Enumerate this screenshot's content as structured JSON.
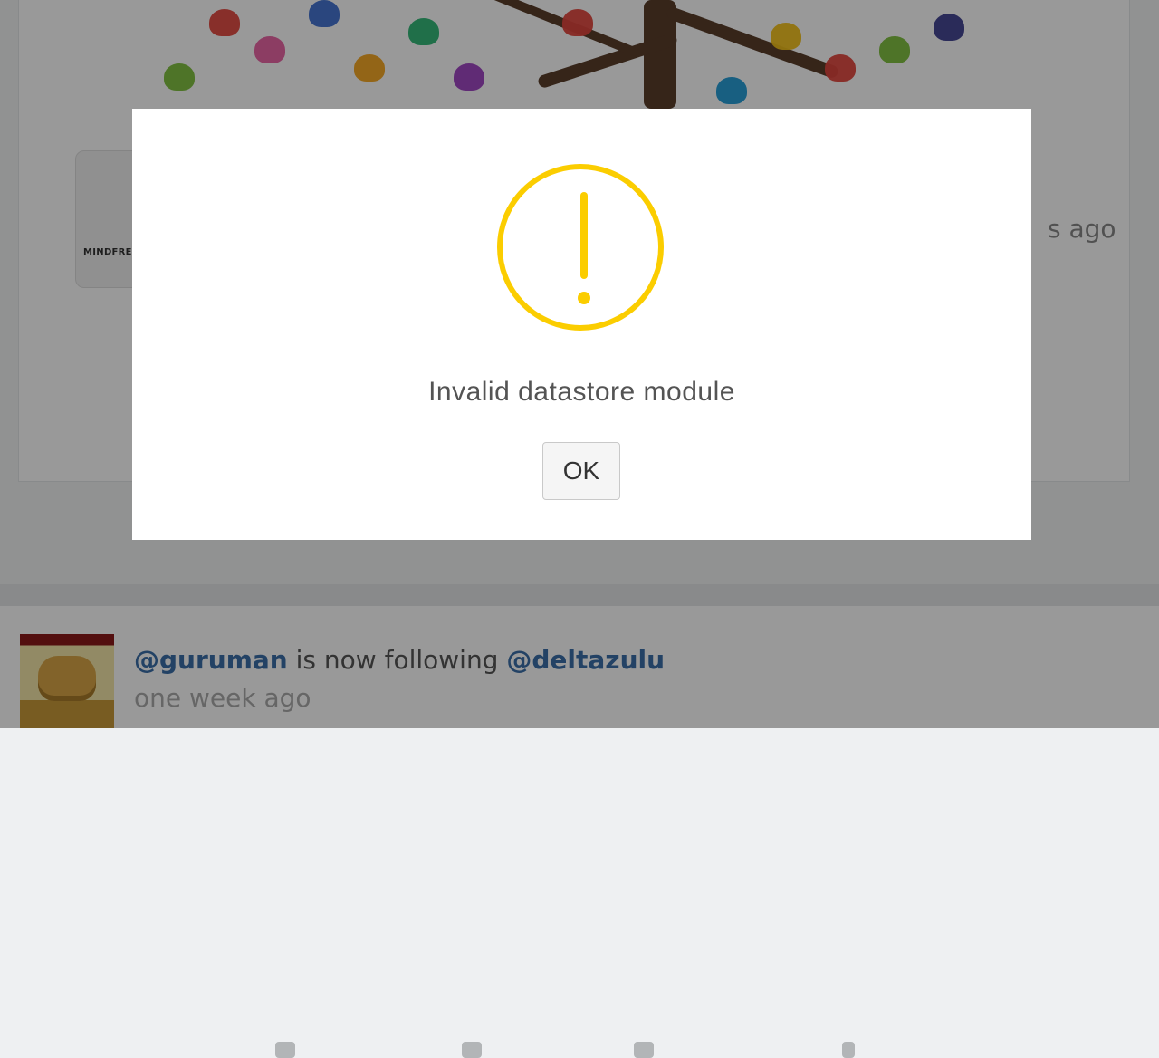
{
  "background": {
    "post": {
      "avatar_label": "MINDFREE",
      "time_fragment": "s ago"
    },
    "feed_item": {
      "actor": "@guruman",
      "action": " is now following ",
      "target": "@deltazulu",
      "time": "one week ago"
    }
  },
  "modal": {
    "icon": "warning-icon",
    "message": "Invalid datastore module",
    "ok_label": "OK"
  },
  "colors": {
    "warning": "#fbcd00",
    "link": "#3b6fa8"
  }
}
